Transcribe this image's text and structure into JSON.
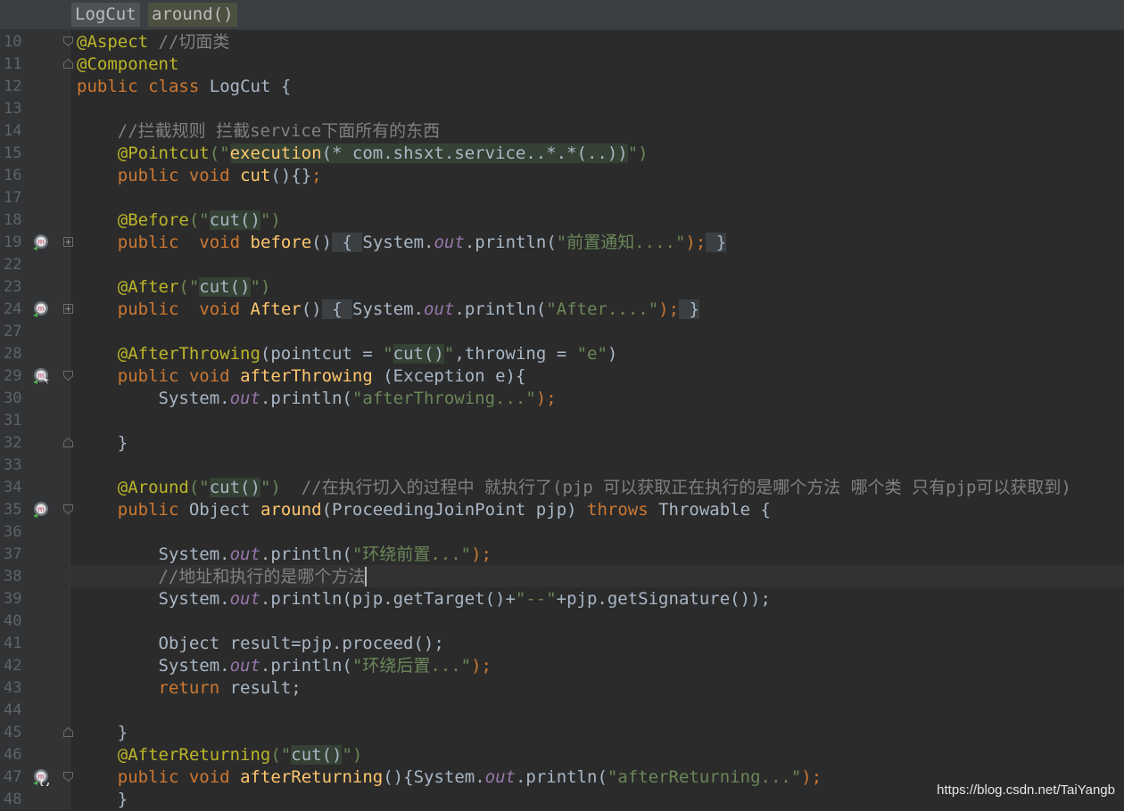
{
  "breadcrumbs": {
    "class_name": "LogCut",
    "method_name": "around()"
  },
  "line_numbers": [
    "10",
    "11",
    "12",
    "13",
    "14",
    "15",
    "16",
    "17",
    "18",
    "19",
    "22",
    "23",
    "24",
    "27",
    "28",
    "29",
    "30",
    "31",
    "32",
    "33",
    "34",
    "35",
    "36",
    "37",
    "38",
    "39",
    "40",
    "41",
    "42",
    "43",
    "44",
    "45",
    "46",
    "47",
    "48"
  ],
  "code": {
    "l10": {
      "anno": "@Aspect",
      "comment": "//切面类"
    },
    "l11": {
      "anno": "@Component"
    },
    "l12": {
      "kw1": "public",
      "kw2": "class",
      "name": "LogCut",
      "brace": "{"
    },
    "l14": {
      "comment": "//拦截规则 拦截service下面所有的东西"
    },
    "l15": {
      "anno": "@Pointcut",
      "p1": "(\"",
      "expr_kw": "execution",
      "expr_rest": "(* com.shsxt.service..*.*(..))",
      "p2": "\")"
    },
    "l16": {
      "kw1": "public",
      "kw2": "void",
      "method": "cut",
      "rest": "(){}",
      "semi": ";"
    },
    "l18": {
      "anno": "@Before",
      "p1": "(\"",
      "ref": "cut()",
      "p2": "\")"
    },
    "l19": {
      "kw1": "public",
      "kw2": "void",
      "method": "before",
      "parens": "()",
      "fold_open": "{",
      "sys": "System.",
      "out": "out",
      "call": ".println(",
      "str": "\"前置通知....\"",
      "close": ");",
      "fold_close": "}"
    },
    "l23": {
      "anno": "@After",
      "p1": "(\"",
      "ref": "cut()",
      "p2": "\")"
    },
    "l24": {
      "kw1": "public",
      "kw2": "void",
      "method": "After",
      "parens": "()",
      "fold_open": "{",
      "sys": "System.",
      "out": "out",
      "call": ".println(",
      "str": "\"After....\"",
      "close": ");",
      "fold_close": "}"
    },
    "l28": {
      "anno": "@AfterThrowing",
      "p1": "(pointcut = ",
      "q1": "\"",
      "ref": "cut()",
      "q2": "\"",
      "mid": ",throwing = ",
      "str": "\"e\"",
      "p2": ")"
    },
    "l29": {
      "kw1": "public",
      "kw2": "void",
      "method": "afterThrowing",
      "rest": " (Exception e){"
    },
    "l30": {
      "sys": "System.",
      "out": "out",
      "call": ".println(",
      "str": "\"afterThrowing...\"",
      "close": ");"
    },
    "l32": {
      "brace": "}"
    },
    "l34": {
      "anno": "@Around",
      "p1": "(\"",
      "ref": "cut()",
      "p2": "\")",
      "comment": "//在执行切入的过程中 就执行了(pjp 可以获取正在执行的是哪个方法 哪个类 只有pjp可以获取到)"
    },
    "l35": {
      "kw1": "public",
      "type": "Object",
      "method": "around",
      "params": "(ProceedingJoinPoint pjp) ",
      "kw2": "throws",
      "rest": " Throwable {"
    },
    "l37": {
      "sys": "System.",
      "out": "out",
      "call": ".println(",
      "str": "\"环绕前置...\"",
      "close": ");"
    },
    "l38": {
      "comment": "//地址和执行的是哪个方法"
    },
    "l39": {
      "sys": "System.",
      "out": "out",
      "call": ".println(pjp.getTarget()+",
      "str": "\"--\"",
      "rest": "+pjp.getSignature());"
    },
    "l41": {
      "text": "Object result=pjp.proceed();"
    },
    "l42": {
      "sys": "System.",
      "out": "out",
      "call": ".println(",
      "str": "\"环绕后置...\"",
      "close": ");"
    },
    "l43": {
      "kw": "return",
      "rest": " result;"
    },
    "l45": {
      "brace": "}"
    },
    "l46": {
      "anno": "@AfterReturning",
      "p1": "(\"",
      "ref": "cut()",
      "p2": "\")"
    },
    "l47": {
      "kw1": "public",
      "kw2": "void",
      "method": "afterReturning",
      "rest": "(){",
      "sys": "System.",
      "out": "out",
      "call": ".println(",
      "str": "\"afterReturning...\"",
      "close": ");"
    },
    "l48": {
      "brace": "}"
    }
  },
  "gutter_icons": [
    "method-icon",
    "method-icon",
    "method-icon",
    "method-icon",
    "method-icon"
  ],
  "watermark": "https://blog.csdn.net/TaiYangb",
  "colors": {
    "keyword": "#cc7832",
    "annotation": "#bbb529",
    "string": "#6a8759",
    "comment": "#808080",
    "field": "#9876aa",
    "method": "#ffc66d",
    "text": "#a9b7c6",
    "background": "#2b2b2b"
  }
}
